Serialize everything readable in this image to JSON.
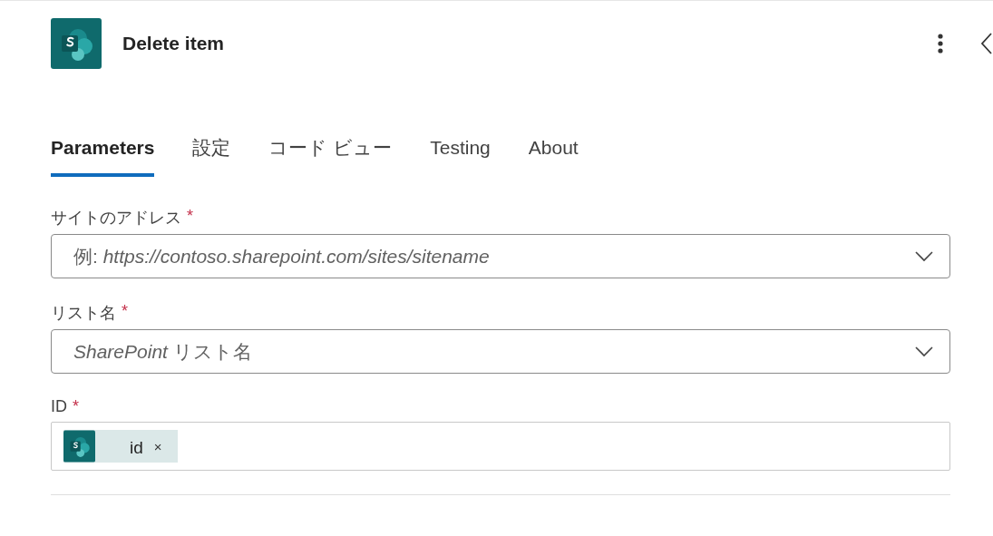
{
  "header": {
    "title": "Delete item"
  },
  "tabs": [
    {
      "label": "Parameters",
      "selected": true
    },
    {
      "label": "設定",
      "selected": false
    },
    {
      "label": "コード ビュー",
      "selected": false
    },
    {
      "label": "Testing",
      "selected": false
    },
    {
      "label": "About",
      "selected": false
    }
  ],
  "fields": [
    {
      "kind": "dropdown",
      "label": "サイトのアドレス",
      "required_mark": "*",
      "placeholder": "例: *https://contoso.sharepoint.com/sites/sitename*"
    },
    {
      "kind": "dropdown",
      "label": "リスト名",
      "required_mark": "*",
      "placeholder": "*SharePoint* リスト名"
    },
    {
      "kind": "tokens",
      "label": "ID",
      "required_mark": "*",
      "tokens": [
        {
          "label": "id",
          "remove_glyph": "×"
        }
      ]
    }
  ]
}
